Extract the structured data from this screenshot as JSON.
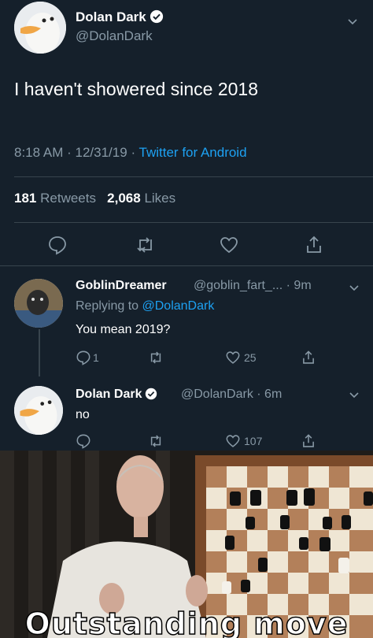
{
  "main_tweet": {
    "name": "Dolan Dark",
    "handle": "@DolanDark",
    "text": "I haven't showered since 2018",
    "time": "8:18 AM",
    "date": "12/31/19",
    "separator": "·",
    "source": "Twitter for Android",
    "retweets_count": "181",
    "retweets_label": "Retweets",
    "likes_count": "2,068",
    "likes_label": "Likes"
  },
  "reply_1": {
    "name": "GoblinDreamer",
    "handle_time": "@goblin_fart_... · 9m",
    "replying_prefix": "Replying to",
    "replying_to": "@DolanDark",
    "text": "You mean 2019?",
    "reply_count": "1",
    "like_count": "25"
  },
  "reply_2": {
    "name": "Dolan Dark",
    "handle_time": "@DolanDark · 6m",
    "text": "no",
    "like_count": "107"
  },
  "meme": {
    "caption": "Outstanding move"
  },
  "colors": {
    "background": "#15202b",
    "accent": "#1da1f2",
    "muted": "#8899a6"
  }
}
